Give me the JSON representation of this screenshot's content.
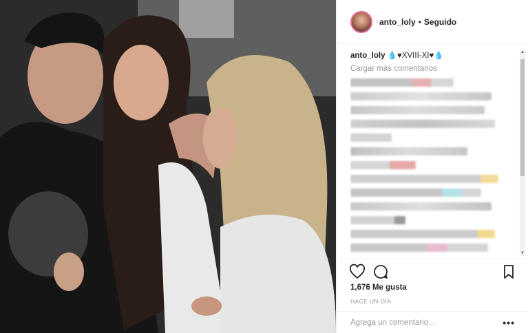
{
  "header": {
    "username": "anto_loly",
    "separator": "•",
    "follow_status": "Seguido"
  },
  "caption": {
    "username": "anto_loly",
    "text": "💧♥XVIII-XI♥💧"
  },
  "comments": {
    "load_more": "Cargar más comentarios"
  },
  "icons": {
    "like": "heart-icon",
    "comment": "comment-bubble-icon",
    "save": "bookmark-icon",
    "more": "more-options-icon"
  },
  "stats": {
    "likes": "1,676 Me gusta",
    "time_ago": "HACE UN DÍA"
  },
  "composer": {
    "placeholder": "Agrega un comentario...",
    "more_label": "•••"
  }
}
